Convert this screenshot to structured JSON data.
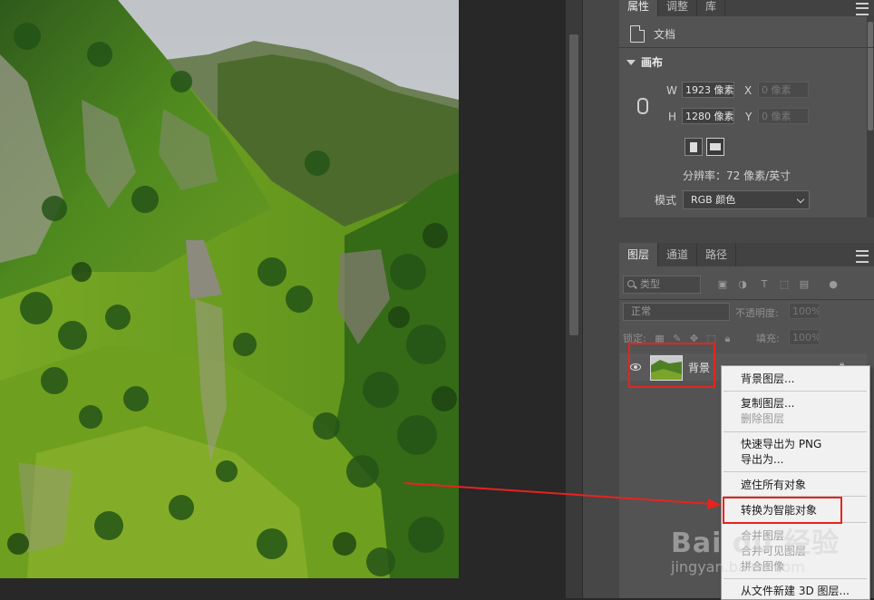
{
  "properties_panel": {
    "tabs": [
      "属性",
      "调整",
      "库"
    ],
    "doc_label": "文档",
    "canvas_section": "画布",
    "width_label": "W",
    "width_value": "1923 像素",
    "height_label": "H",
    "height_value": "1280 像素",
    "x_label": "X",
    "x_placeholder": "0 像素",
    "y_label": "Y",
    "y_placeholder": "0 像素",
    "resolution": "分辨率：72 像素/英寸",
    "mode_label": "模式",
    "mode_value": "RGB 颜色"
  },
  "layers_panel": {
    "tabs": [
      "图层",
      "通道",
      "路径"
    ],
    "filter_placeholder": "类型",
    "blend_mode": "正常",
    "opacity_label": "不透明度:",
    "opacity_value": "100%",
    "lock_label": "锁定:",
    "fill_label": "填充:",
    "fill_value": "100%",
    "layer_name": "背景"
  },
  "context_menu": {
    "items": [
      {
        "label": "背景图层...",
        "enabled": true
      },
      {
        "label": "复制图层...",
        "enabled": true
      },
      {
        "label": "删除图层",
        "enabled": false
      },
      {
        "label": "快速导出为 PNG",
        "enabled": true
      },
      {
        "label": "导出为...",
        "enabled": true
      },
      {
        "label": "遮住所有对象",
        "enabled": true
      },
      {
        "label": "转换为智能对象",
        "enabled": true
      },
      {
        "label": "合并图层",
        "enabled": false
      },
      {
        "label": "合并可见图层",
        "enabled": false
      },
      {
        "label": "拼合图像",
        "enabled": false
      },
      {
        "label": "从文件新建 3D 图层...",
        "enabled": true
      }
    ]
  },
  "annotations": {
    "highlight_color": "#e8231d"
  },
  "watermark": {
    "logo": "Bai du 经验",
    "site": "jingyan.baidu.com"
  }
}
